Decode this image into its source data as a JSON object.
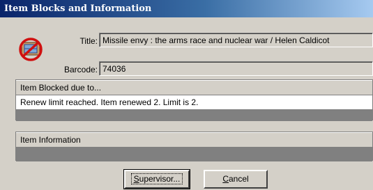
{
  "window": {
    "title": "Item Blocks and Information"
  },
  "item": {
    "title_label": "Title:",
    "title_value": "Missile envy : the arms race and nuclear war / Helen Caldicot",
    "barcode_label": "Barcode:",
    "barcode_value": "74036"
  },
  "blocked": {
    "header": "Item Blocked due to...",
    "rows": [
      "Renew limit reached.  Item renewed 2.  Limit is 2."
    ]
  },
  "information": {
    "header": "Item Information"
  },
  "buttons": {
    "supervisor_accel": "S",
    "supervisor_rest": "upervisor...",
    "cancel_accel": "C",
    "cancel_rest": "ancel"
  },
  "icons": {
    "app_icon": "blocked-item-icon"
  }
}
